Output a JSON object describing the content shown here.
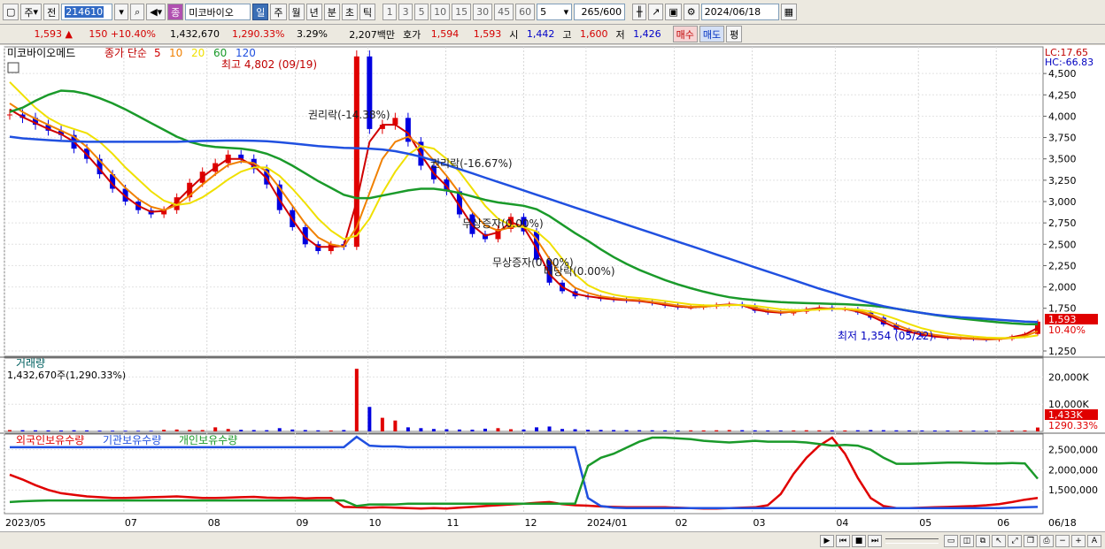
{
  "toolbar": {
    "market_label": "주",
    "prev_label": "전",
    "stock_code": "214610",
    "stock_name": "미코바이오",
    "stock_badge": "종",
    "period_tabs": [
      "일",
      "주",
      "월",
      "년",
      "분",
      "초",
      "틱"
    ],
    "active_period": "일",
    "interval_buttons": [
      "1",
      "3",
      "5",
      "10",
      "15",
      "30",
      "45",
      "60"
    ],
    "interval_value": "5",
    "count_display": "265",
    "count_max": "/600",
    "date_value": "2024/06/18"
  },
  "quote": {
    "price": "1,593",
    "change": "150",
    "change_pct": "+10.40%",
    "volume": "1,432,670",
    "volume_ratio": "1,290.33%",
    "turnover": "3.29%",
    "amount": "2,207백만",
    "ask_label": "호가",
    "ask": "1,594",
    "bid": "1,593",
    "open_label": "시",
    "open": "1,442",
    "high_label": "고",
    "high": "1,600",
    "low_label": "저",
    "low": "1,426",
    "buy_label": "매수",
    "sell_label": "매도",
    "avg_label": "평"
  },
  "colors": {
    "ma5": "#d00000",
    "ma10": "#f08000",
    "ma20": "#f0e000",
    "ma60": "#1a9a2a",
    "ma120": "#2050e0",
    "up": "#e00000",
    "down": "#0000e0",
    "foreign": "#e00000",
    "institution": "#2050e0",
    "individual": "#1a9a2a"
  },
  "chart_data": [
    {
      "type": "candlestick",
      "title": "미코바이오메드",
      "legend": {
        "label": "종가 단순",
        "periods": [
          "5",
          "10",
          "20",
          "60",
          "120"
        ]
      },
      "x_ticks": [
        "2023/05",
        "07",
        "08",
        "09",
        "10",
        "11",
        "12",
        "2024/01",
        "02",
        "03",
        "04",
        "05",
        "06"
      ],
      "y_ticks": [
        "4,500",
        "4,250",
        "4,000",
        "3,750",
        "3,500",
        "3,250",
        "3,000",
        "2,750",
        "2,500",
        "2,250",
        "2,000",
        "1,750",
        "1,250"
      ],
      "ylim": [
        1250,
        4750
      ],
      "right_top_labels": [
        "LC:17.65",
        "HC:-66.83"
      ],
      "last_price_tag": "1,593",
      "last_pct_tag": "10.40%",
      "annotations": {
        "high": "최고 4,802 (09/19)",
        "low": "최저 1,354 (05/22)",
        "events": [
          "권리락(-14.38%)",
          "권리락(-16.67%)",
          "무상증자(0.00%)",
          "무상증자(0.00%)",
          "배당락(0.00%)"
        ]
      },
      "series": [
        {
          "name": "가격",
          "values": [
            4020,
            3980,
            3900,
            3830,
            3780,
            3620,
            3500,
            3320,
            3150,
            3000,
            2900,
            2850,
            2900,
            3050,
            3220,
            3350,
            3450,
            3550,
            3500,
            3380,
            3200,
            2900,
            2700,
            2500,
            2420,
            2500,
            2470,
            4700,
            3850,
            3900,
            3980,
            3700,
            3420,
            3260,
            3120,
            2850,
            2620,
            2560,
            2680,
            2820,
            2650,
            2320,
            2050,
            1950,
            1890,
            1880,
            1860,
            1850,
            1840,
            1830,
            1810,
            1780,
            1760,
            1760,
            1770,
            1790,
            1800,
            1780,
            1720,
            1700,
            1690,
            1710,
            1740,
            1760,
            1740,
            1740,
            1700,
            1640,
            1560,
            1500,
            1460,
            1420,
            1410,
            1400,
            1400,
            1390,
            1380,
            1390,
            1420,
            1450,
            1593
          ]
        },
        {
          "name": "5",
          "values": [
            4080,
            3990,
            3920,
            3850,
            3790,
            3700,
            3550,
            3380,
            3200,
            3060,
            2950,
            2880,
            2890,
            3000,
            3150,
            3290,
            3400,
            3500,
            3500,
            3420,
            3270,
            3020,
            2790,
            2580,
            2470,
            2470,
            2480,
            3000,
            3700,
            3900,
            3900,
            3800,
            3550,
            3330,
            3180,
            2950,
            2720,
            2600,
            2640,
            2760,
            2700,
            2450,
            2150,
            2000,
            1920,
            1890,
            1870,
            1855,
            1845,
            1835,
            1815,
            1790,
            1770,
            1762,
            1768,
            1785,
            1795,
            1785,
            1735,
            1710,
            1698,
            1710,
            1735,
            1752,
            1745,
            1742,
            1712,
            1660,
            1590,
            1520,
            1475,
            1440,
            1420,
            1405,
            1400,
            1392,
            1385,
            1390,
            1412,
            1442,
            1520
          ]
        },
        {
          "name": "10",
          "values": [
            4150,
            4050,
            3970,
            3900,
            3830,
            3760,
            3640,
            3480,
            3320,
            3160,
            3030,
            2940,
            2900,
            2960,
            3070,
            3200,
            3320,
            3430,
            3470,
            3450,
            3350,
            3160,
            2950,
            2740,
            2580,
            2500,
            2470,
            2700,
            3100,
            3500,
            3700,
            3760,
            3650,
            3480,
            3300,
            3100,
            2880,
            2720,
            2660,
            2700,
            2720,
            2560,
            2330,
            2120,
            1990,
            1930,
            1890,
            1870,
            1855,
            1845,
            1825,
            1805,
            1782,
            1768,
            1768,
            1780,
            1790,
            1788,
            1755,
            1725,
            1708,
            1708,
            1725,
            1740,
            1745,
            1743,
            1722,
            1680,
            1620,
            1555,
            1500,
            1465,
            1440,
            1420,
            1408,
            1398,
            1390,
            1390,
            1402,
            1425,
            1480
          ]
        },
        {
          "name": "20",
          "values": [
            4400,
            4250,
            4100,
            3980,
            3900,
            3850,
            3800,
            3700,
            3560,
            3400,
            3260,
            3120,
            3010,
            2960,
            2980,
            3050,
            3150,
            3260,
            3350,
            3400,
            3400,
            3300,
            3150,
            2980,
            2800,
            2660,
            2560,
            2600,
            2800,
            3100,
            3350,
            3550,
            3650,
            3620,
            3500,
            3350,
            3150,
            2950,
            2800,
            2720,
            2700,
            2650,
            2520,
            2330,
            2150,
            2020,
            1950,
            1910,
            1885,
            1870,
            1855,
            1835,
            1815,
            1795,
            1785,
            1782,
            1785,
            1788,
            1778,
            1758,
            1738,
            1728,
            1728,
            1736,
            1742,
            1744,
            1736,
            1712,
            1672,
            1622,
            1565,
            1515,
            1480,
            1455,
            1435,
            1420,
            1408,
            1402,
            1402,
            1410,
            1432
          ]
        },
        {
          "name": "60",
          "values": [
            4050,
            4100,
            4180,
            4250,
            4300,
            4290,
            4260,
            4210,
            4150,
            4080,
            4000,
            3920,
            3840,
            3760,
            3700,
            3660,
            3640,
            3630,
            3620,
            3600,
            3560,
            3500,
            3420,
            3330,
            3240,
            3160,
            3080,
            3040,
            3040,
            3070,
            3100,
            3130,
            3150,
            3150,
            3130,
            3100,
            3060,
            3020,
            2990,
            2970,
            2950,
            2910,
            2830,
            2730,
            2630,
            2540,
            2440,
            2350,
            2270,
            2200,
            2140,
            2080,
            2030,
            1985,
            1945,
            1910,
            1880,
            1860,
            1845,
            1832,
            1822,
            1815,
            1810,
            1806,
            1802,
            1798,
            1790,
            1780,
            1765,
            1745,
            1720,
            1695,
            1670,
            1650,
            1630,
            1615,
            1600,
            1585,
            1573,
            1565,
            1562
          ]
        },
        {
          "name": "120",
          "values": [
            3760,
            3740,
            3730,
            3720,
            3710,
            3705,
            3700,
            3700,
            3700,
            3700,
            3700,
            3700,
            3700,
            3700,
            3705,
            3710,
            3712,
            3714,
            3714,
            3712,
            3706,
            3695,
            3680,
            3665,
            3650,
            3640,
            3630,
            3625,
            3620,
            3610,
            3590,
            3560,
            3525,
            3480,
            3430,
            3380,
            3330,
            3280,
            3230,
            3180,
            3130,
            3080,
            3030,
            2980,
            2930,
            2880,
            2830,
            2780,
            2730,
            2680,
            2630,
            2580,
            2530,
            2480,
            2430,
            2380,
            2330,
            2280,
            2230,
            2180,
            2130,
            2080,
            2030,
            1980,
            1935,
            1890,
            1850,
            1810,
            1775,
            1745,
            1718,
            1695,
            1675,
            1658,
            1645,
            1635,
            1625,
            1615,
            1605,
            1595,
            1590
          ]
        }
      ]
    },
    {
      "type": "bar",
      "title": "거래량",
      "value_label": "1,432,670주(1,290.33%)",
      "y_ticks": [
        "20,000K",
        "10,000K"
      ],
      "ylim": [
        0,
        25000
      ],
      "last_tag": "1,433K",
      "last_pct_tag": "1290.33%",
      "values": [
        500,
        450,
        400,
        380,
        350,
        420,
        380,
        300,
        280,
        260,
        250,
        240,
        600,
        700,
        550,
        500,
        1500,
        900,
        600,
        500,
        450,
        1200,
        700,
        500,
        400,
        350,
        500,
        23000,
        9000,
        5000,
        4000,
        1500,
        1200,
        900,
        800,
        700,
        650,
        1000,
        1200,
        800,
        700,
        1500,
        1800,
        900,
        800,
        600,
        550,
        500,
        480,
        450,
        420,
        400,
        380,
        400,
        380,
        420,
        500,
        450,
        400,
        380,
        360,
        380,
        420,
        400,
        380,
        360,
        420,
        500,
        450,
        400,
        380,
        360,
        350,
        340,
        330,
        320,
        310,
        330,
        350,
        380,
        1433
      ]
    },
    {
      "type": "line",
      "y_ticks": [
        "2,500,000",
        "2,000,000",
        "1,500,000"
      ],
      "ylim": [
        1000000,
        2800000
      ],
      "series": [
        {
          "name": "외국인보유수량",
          "values": [
            1880000,
            1760000,
            1620000,
            1500000,
            1420000,
            1380000,
            1340000,
            1320000,
            1300000,
            1300000,
            1310000,
            1320000,
            1330000,
            1340000,
            1320000,
            1300000,
            1300000,
            1310000,
            1320000,
            1330000,
            1310000,
            1300000,
            1310000,
            1290000,
            1300000,
            1300000,
            1080000,
            1070000,
            1060000,
            1070000,
            1060000,
            1050000,
            1040000,
            1050000,
            1040000,
            1060000,
            1080000,
            1100000,
            1120000,
            1140000,
            1160000,
            1180000,
            1200000,
            1150000,
            1120000,
            1110000,
            1090000,
            1080000,
            1070000,
            1070000,
            1070000,
            1070000,
            1060000,
            1050000,
            1040000,
            1040000,
            1050000,
            1060000,
            1070000,
            1120000,
            1400000,
            1900000,
            2300000,
            2600000,
            2800000,
            2400000,
            1800000,
            1300000,
            1100000,
            1050000,
            1050000,
            1060000,
            1070000,
            1080000,
            1090000,
            1100000,
            1120000,
            1150000,
            1200000,
            1260000,
            1300000
          ]
        },
        {
          "name": "기관보유수량",
          "values": [
            2560000,
            2560000,
            2560000,
            2560000,
            2560000,
            2560000,
            2560000,
            2560000,
            2560000,
            2560000,
            2560000,
            2560000,
            2560000,
            2560000,
            2560000,
            2560000,
            2560000,
            2560000,
            2560000,
            2560000,
            2560000,
            2560000,
            2560000,
            2560000,
            2560000,
            2560000,
            2560000,
            2820000,
            2600000,
            2580000,
            2580000,
            2560000,
            2560000,
            2560000,
            2560000,
            2560000,
            2560000,
            2560000,
            2560000,
            2560000,
            2560000,
            2560000,
            2560000,
            2560000,
            2560000,
            1300000,
            1100000,
            1060000,
            1050000,
            1050000,
            1050000,
            1050000,
            1050000,
            1050000,
            1050000,
            1050000,
            1050000,
            1050000,
            1050000,
            1050000,
            1050000,
            1050000,
            1050000,
            1050000,
            1050000,
            1050000,
            1050000,
            1050000,
            1050000,
            1050000,
            1050000,
            1050000,
            1050000,
            1050000,
            1050000,
            1050000,
            1050000,
            1050000,
            1060000,
            1070000,
            1080000
          ]
        },
        {
          "name": "개인보유수량",
          "values": [
            1200000,
            1220000,
            1230000,
            1240000,
            1240000,
            1240000,
            1240000,
            1240000,
            1240000,
            1240000,
            1240000,
            1240000,
            1240000,
            1240000,
            1240000,
            1240000,
            1240000,
            1240000,
            1240000,
            1240000,
            1240000,
            1240000,
            1240000,
            1240000,
            1240000,
            1240000,
            1240000,
            1100000,
            1140000,
            1140000,
            1140000,
            1160000,
            1160000,
            1160000,
            1160000,
            1160000,
            1160000,
            1160000,
            1160000,
            1160000,
            1160000,
            1160000,
            1160000,
            1160000,
            1160000,
            2100000,
            2300000,
            2400000,
            2550000,
            2700000,
            2800000,
            2800000,
            2780000,
            2760000,
            2720000,
            2700000,
            2680000,
            2700000,
            2720000,
            2700000,
            2700000,
            2700000,
            2680000,
            2640000,
            2600000,
            2620000,
            2600000,
            2500000,
            2300000,
            2150000,
            2150000,
            2160000,
            2170000,
            2180000,
            2180000,
            2170000,
            2160000,
            2160000,
            2170000,
            2160000,
            1780000
          ]
        }
      ]
    }
  ]
}
